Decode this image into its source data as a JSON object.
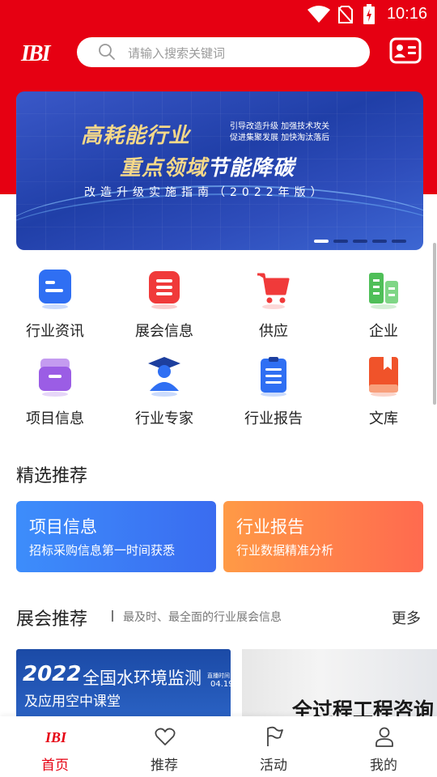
{
  "status_bar": {
    "time": "10:16"
  },
  "header": {
    "logo_text": "IBI",
    "search_placeholder": "请输入搜索关键词",
    "card_icon": "id-card-icon"
  },
  "banner": {
    "line1": "高耗能行业",
    "line1_side_1": "引导改造升级 加强技术攻关",
    "line1_side_2": "促进集聚发展 加快淘汰落后",
    "line2_a": "重点领域",
    "line2_b": "节能降碳",
    "line3": "改造升级实施指南（2022年版）",
    "slide_count": 5,
    "active_slide": 1
  },
  "grid": [
    {
      "label": "行业资讯",
      "icon": "news-icon",
      "color": "#2f6ff3"
    },
    {
      "label": "展会信息",
      "icon": "exhibition-icon",
      "color": "#f03a3a"
    },
    {
      "label": "供应",
      "icon": "cart-icon",
      "color": "#f03a3a"
    },
    {
      "label": "企业",
      "icon": "buildings-icon",
      "color": "#4fbf58"
    },
    {
      "label": "项目信息",
      "icon": "project-icon",
      "color": "#9b5de5"
    },
    {
      "label": "行业专家",
      "icon": "expert-icon",
      "color": "#2f6ff3"
    },
    {
      "label": "行业报告",
      "icon": "report-icon",
      "color": "#2f6ff3"
    },
    {
      "label": "文库",
      "icon": "library-icon",
      "color": "#f0532a"
    }
  ],
  "featured": {
    "title": "精选推荐",
    "cards": [
      {
        "title": "项目信息",
        "desc": "招标采购信息第一时间获悉"
      },
      {
        "title": "行业报告",
        "desc": "行业数据精准分析"
      }
    ]
  },
  "expo": {
    "title": "展会推荐",
    "subtitle": "最及时、最全面的行业展会信息",
    "more": "更多",
    "items": [
      {
        "year": "2022",
        "title": "全国水环境监测",
        "subtitle": "及应用空中课堂",
        "time_label": "直播时间",
        "date": "04.19"
      },
      {
        "title": "全过程工程咨询"
      }
    ]
  },
  "bottom_nav": [
    {
      "label": "首页",
      "icon": "home-logo-icon",
      "active": true
    },
    {
      "label": "推荐",
      "icon": "heart-icon",
      "active": false
    },
    {
      "label": "活动",
      "icon": "flag-icon",
      "active": false
    },
    {
      "label": "我的",
      "icon": "person-icon",
      "active": false
    }
  ],
  "colors": {
    "brand_red": "#e60012",
    "accent_blue": "#3a6cf0",
    "accent_orange": "#ff6a4f"
  }
}
